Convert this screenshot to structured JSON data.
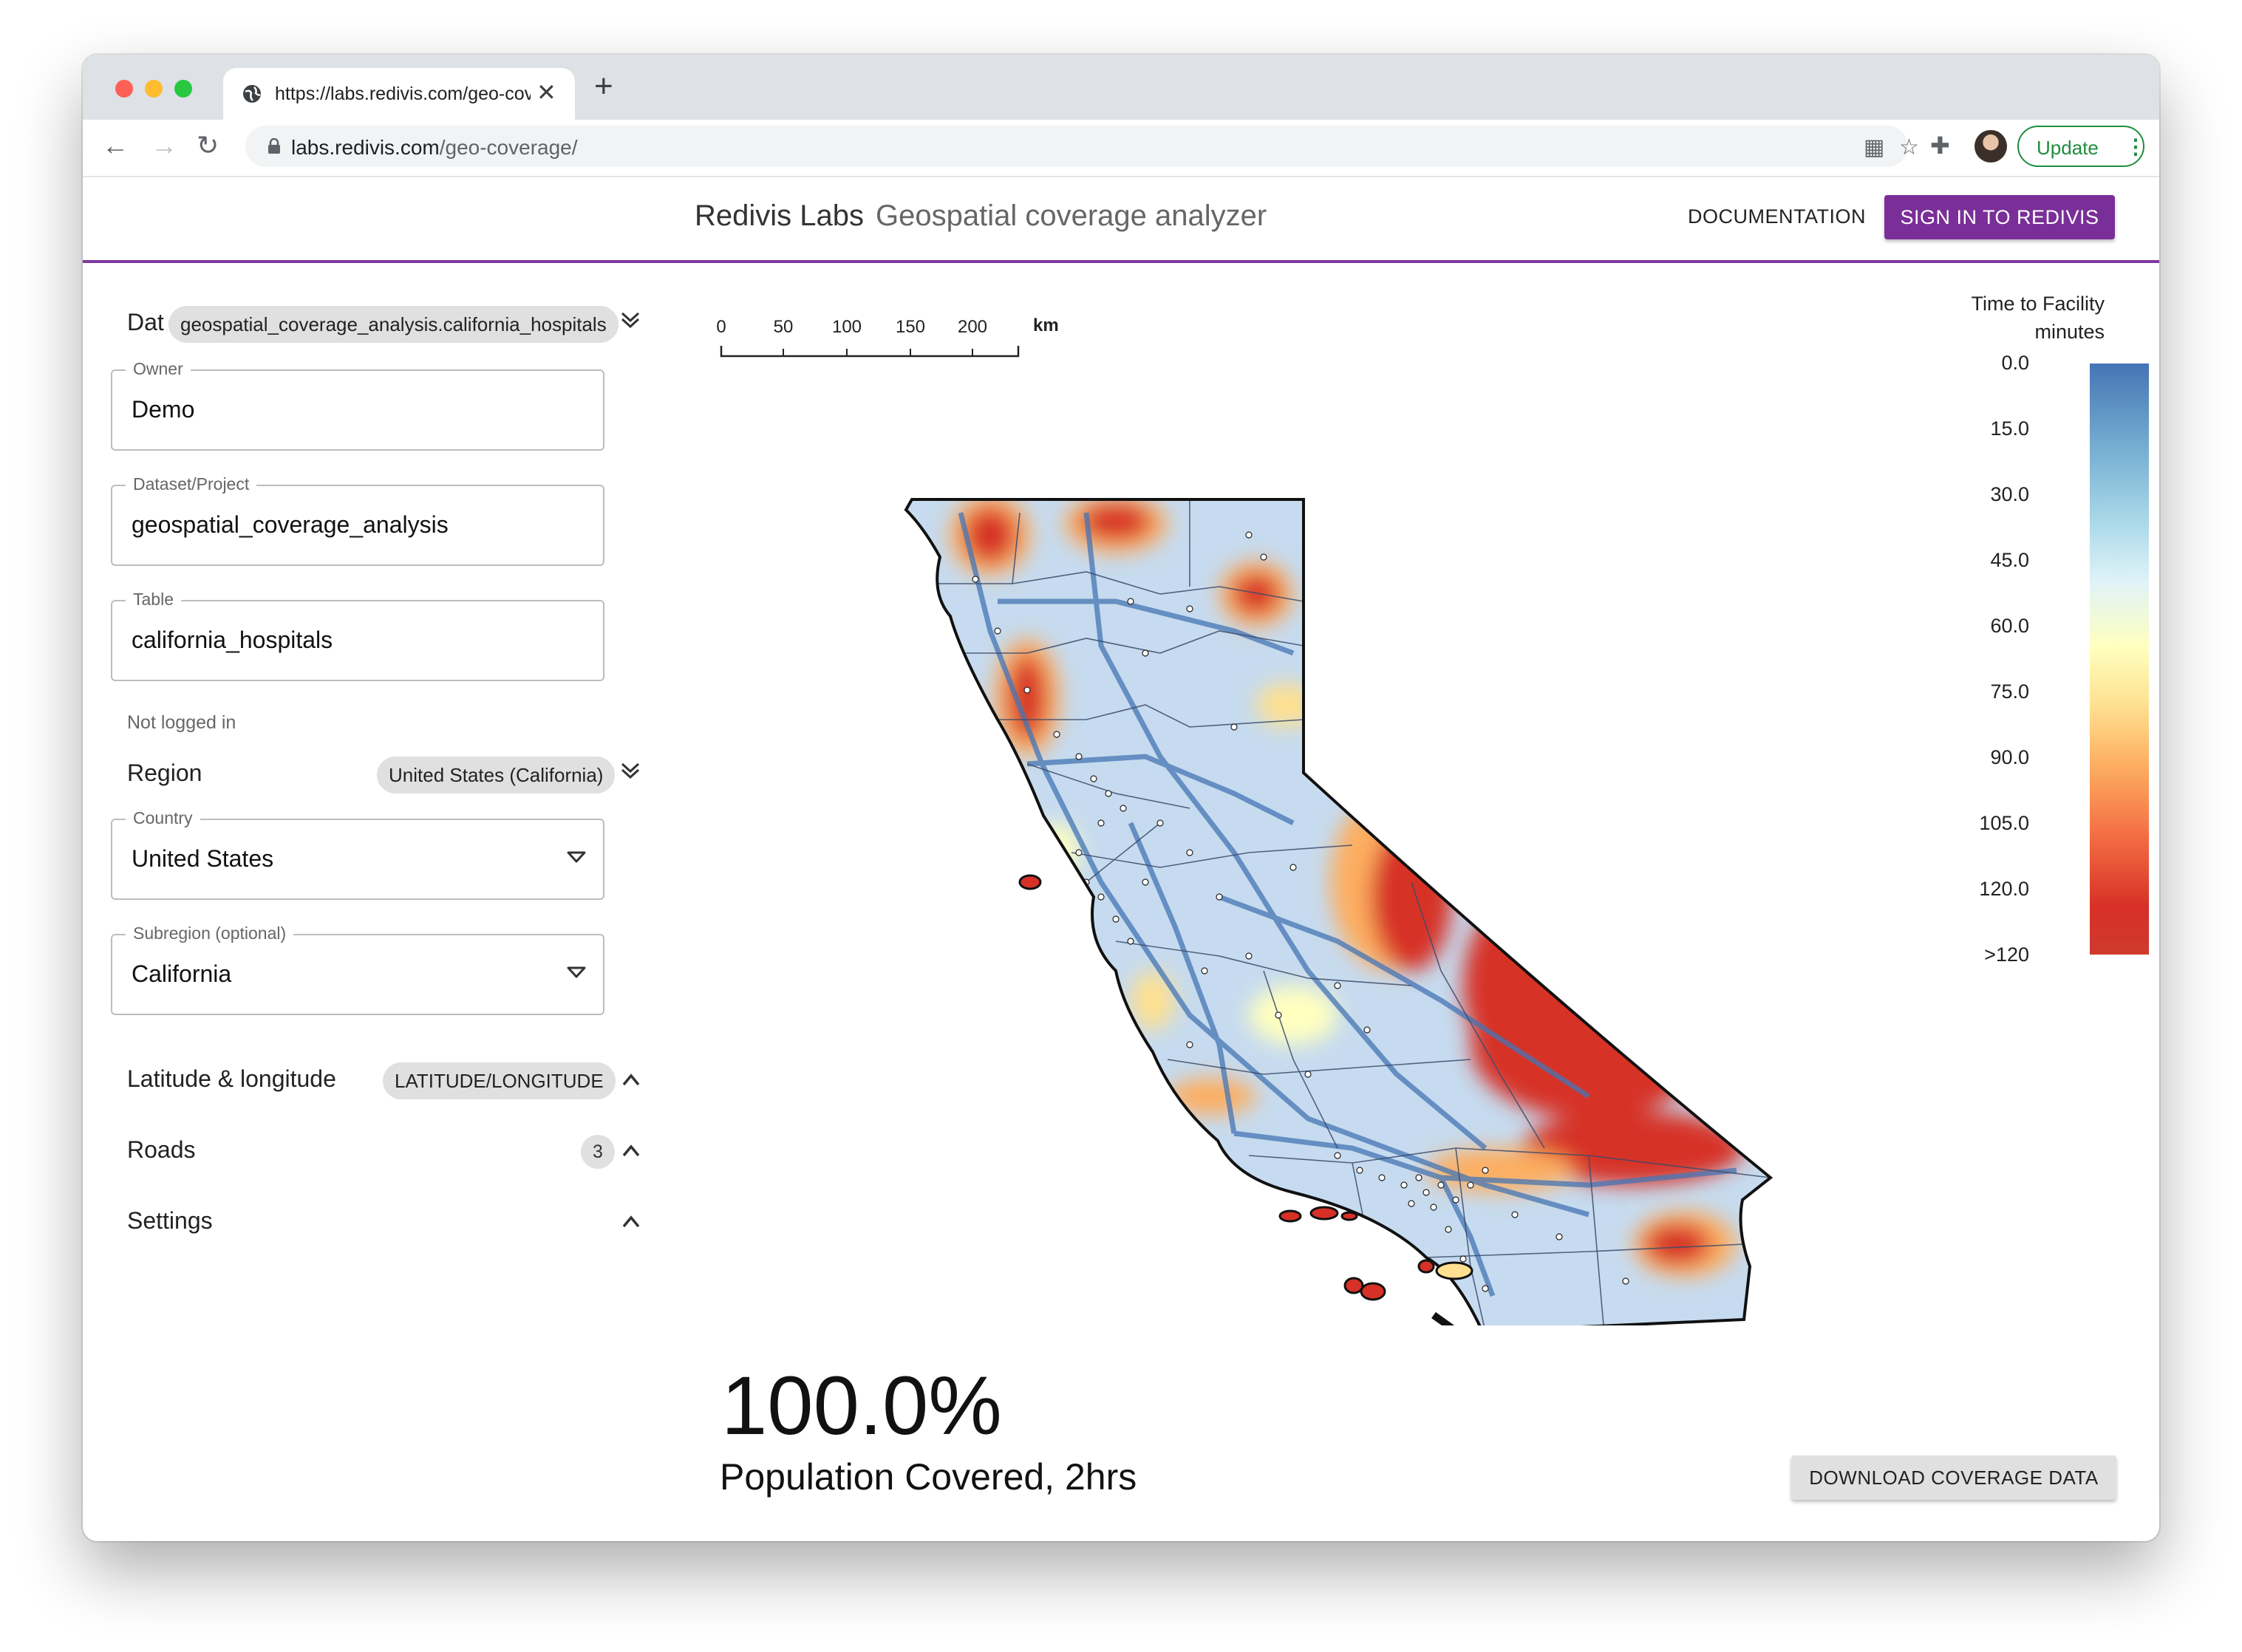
{
  "browser": {
    "tab_title": "https://labs.redivis.com/geo-coverage/",
    "url_host": "labs.redivis.com",
    "url_path": "/geo-coverage/",
    "update_label": "Update",
    "new_tab_glyph": "+",
    "close_glyph": "✕"
  },
  "header": {
    "brand": "Redivis Labs",
    "subtitle": "Geospatial coverage analyzer",
    "documentation": "DOCUMENTATION",
    "sign_in": "SIGN IN TO REDIVIS",
    "accent_color": "#7a2f98"
  },
  "sidebar": {
    "data_label": "Dat",
    "data_chip": "geospatial_coverage_analysis.california_hospitals",
    "owner_label": "Owner",
    "owner_value": "Demo",
    "dataset_label": "Dataset/Project",
    "dataset_value": "geospatial_coverage_analysis",
    "table_label": "Table",
    "table_value": "california_hospitals",
    "login_status": "Not logged in",
    "region_label": "Region",
    "region_chip": "United States (California)",
    "country_label": "Country",
    "country_value": "United States",
    "subregion_label": "Subregion (optional)",
    "subregion_value": "California",
    "latlng_label": "Latitude & longitude",
    "latlng_chip": "LATITUDE/LONGITUDE",
    "roads_label": "Roads",
    "roads_count": "3",
    "settings_label": "Settings"
  },
  "scale": {
    "ticks": [
      "0",
      "50",
      "100",
      "150",
      "200"
    ],
    "unit": "km"
  },
  "legend": {
    "title": "Time to Facility",
    "subtitle": "minutes",
    "ticks": [
      "0.0",
      "15.0",
      "30.0",
      "45.0",
      "60.0",
      "75.0",
      "90.0",
      "105.0",
      "120.0",
      ">120"
    ],
    "colors": [
      "#4575b4",
      "#abd9e9",
      "#ffffbf",
      "#fdae61",
      "#d73027"
    ]
  },
  "stats": {
    "value": "100.0%",
    "label": "Population Covered, 2hrs"
  },
  "download_label": "DOWNLOAD COVERAGE DATA"
}
